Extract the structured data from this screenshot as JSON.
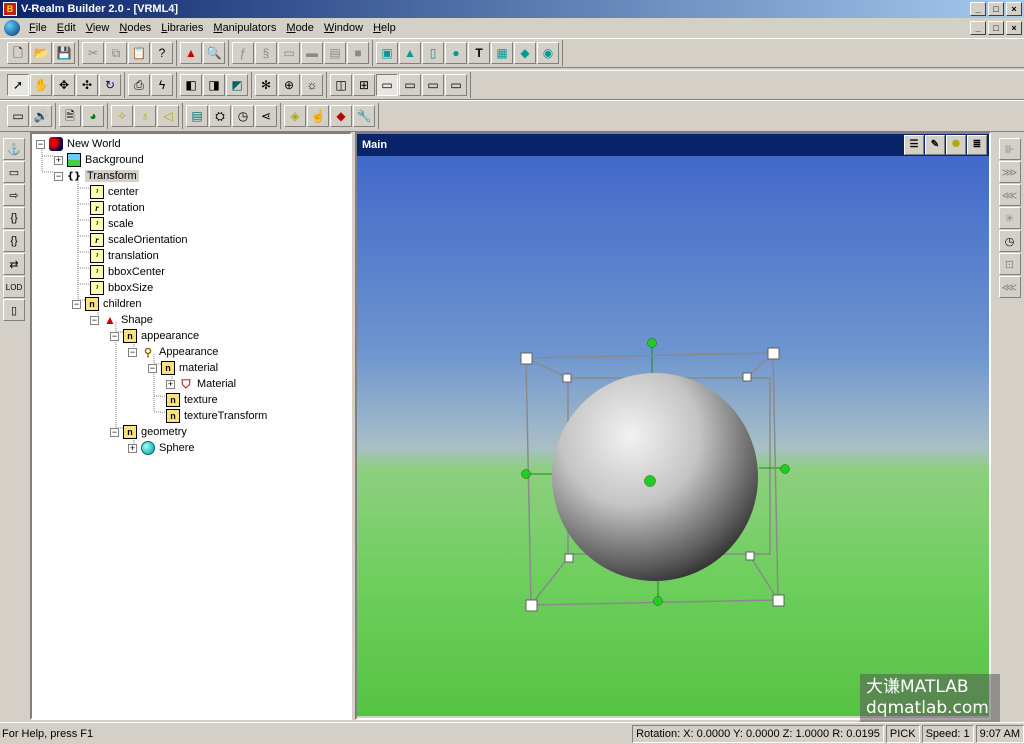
{
  "window": {
    "title": "V-Realm Builder 2.0 - [VRML4]",
    "app_icon_letter": "B"
  },
  "window_buttons": [
    "_",
    "□",
    "×"
  ],
  "menubar": {
    "items": [
      "File",
      "Edit",
      "View",
      "Nodes",
      "Libraries",
      "Manipulators",
      "Mode",
      "Window",
      "Help"
    ]
  },
  "toolbar1": {
    "groups": [
      [
        "new-icon",
        "open-icon",
        "save-icon"
      ],
      [
        "cut-icon",
        "copy-icon",
        "paste-icon",
        "help-icon"
      ],
      [
        "add-node-icon",
        "find-icon"
      ],
      [
        "fields-icon",
        "script-icon",
        "proto-icon",
        "inline-icon",
        "group-icon",
        "box-icon"
      ],
      [
        "box-geometry-icon",
        "cone-icon",
        "cylinder-icon",
        "sphere-icon",
        "text-icon",
        "grid-icon",
        "extrusion-icon",
        "world-icon"
      ]
    ]
  },
  "toolbar2": {
    "groups": [
      [
        "select-pointer-icon",
        "walk-icon",
        "move-icon",
        "pan-icon",
        "rotate-icon"
      ],
      [
        "navigate-icon",
        "lightning-icon"
      ],
      [
        "view1-icon",
        "view2-icon",
        "view3-icon"
      ],
      [
        "snap-icon",
        "globe-icon",
        "light-icon"
      ],
      [
        "layout1-icon",
        "layout2-icon",
        "layout3-icon",
        "layout4-icon",
        "layout5-icon",
        "layout6-icon"
      ]
    ]
  },
  "toolbar3": {
    "groups": [
      [
        "audio-clip-icon",
        "sound-icon"
      ],
      [
        "document-icon",
        "world-info-icon"
      ],
      [
        "pointlight-icon",
        "bulb-icon",
        "spotlight-icon"
      ],
      [
        "background-icon",
        "viewpoint-icon",
        "timer-icon",
        "collision-icon"
      ],
      [
        "proximity-icon",
        "touch-icon",
        "cylinder-sensor-icon",
        "plane-sensor-icon"
      ]
    ]
  },
  "tree": {
    "rows": [
      {
        "label": "New World",
        "icon": "world"
      },
      {
        "label": "Background",
        "icon": "background",
        "expander": "+"
      },
      {
        "label": "Transform",
        "icon": "transform",
        "expander": "-",
        "selected": true
      },
      {
        "label": "center",
        "icon": "field",
        "glyph": "¹"
      },
      {
        "label": "rotation",
        "icon": "field",
        "glyph": "r"
      },
      {
        "label": "scale",
        "icon": "field",
        "glyph": "¹"
      },
      {
        "label": "scaleOrientation",
        "icon": "field",
        "glyph": "r"
      },
      {
        "label": "translation",
        "icon": "field",
        "glyph": "¹"
      },
      {
        "label": "bboxCenter",
        "icon": "field",
        "glyph": "¹"
      },
      {
        "label": "bboxSize",
        "icon": "field",
        "glyph": "¹"
      },
      {
        "label": "children",
        "icon": "n",
        "expander": "-"
      },
      {
        "label": "Shape",
        "icon": "shape",
        "expander": "-"
      },
      {
        "label": "appearance",
        "icon": "n",
        "expander": "-"
      },
      {
        "label": "Appearance",
        "icon": "appearance",
        "expander": "-"
      },
      {
        "label": "material",
        "icon": "n",
        "expander": "-"
      },
      {
        "label": "Material",
        "icon": "material",
        "expander": "+"
      },
      {
        "label": "texture",
        "icon": "n"
      },
      {
        "label": "textureTransform",
        "icon": "n"
      },
      {
        "label": "geometry",
        "icon": "n",
        "expander": "-"
      },
      {
        "label": "Sphere",
        "icon": "sphere",
        "expander": "+"
      }
    ]
  },
  "viewport": {
    "title": "Main"
  },
  "watermark": {
    "line1": "大谦MATLAB",
    "line2": "dqmatlab.com"
  },
  "statusbar": {
    "help": "For Help, press F1",
    "rotation": "Rotation: X: 0.0000  Y: 0.0000  Z: 1.0000  R: 0.0195",
    "mode": "PICK",
    "speed": "Speed: 1",
    "time": "9:07 AM"
  },
  "colors": {
    "title_bar": "#0a246a",
    "sky": "#4169c9",
    "ground": "#55c342",
    "manipulator_handle": "#22cc22"
  }
}
